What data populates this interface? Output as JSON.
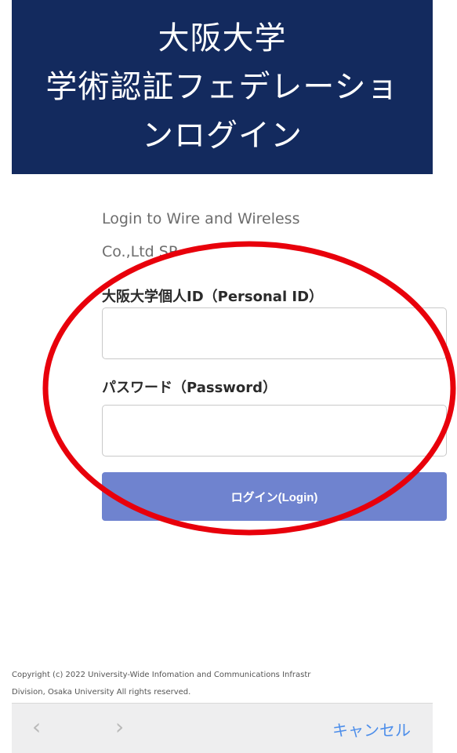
{
  "header": {
    "title_line1": "大阪大学",
    "title_line2": "学術認証フェデレーショ",
    "title_line3": "ンログイン"
  },
  "sp": {
    "line1": "Login to Wire and Wireless",
    "line2": "Co.,Ltd SP"
  },
  "form": {
    "id_label": "大阪大学個人ID（Personal ID）",
    "id_value": "",
    "password_label": "パスワード（Password）",
    "password_value": "",
    "login_button": "ログイン(Login)"
  },
  "footer": {
    "copyright_line1": "Copyright (c) 2022 University-Wide Infomation and Communications Infrastr",
    "copyright_line2": "Division, Osaka University All rights reserved."
  },
  "toolbar": {
    "back_icon": "chevron-left-icon",
    "forward_icon": "chevron-right-icon",
    "cancel_label": "キャンセル"
  },
  "colors": {
    "header_bg": "#132a5e",
    "login_button": "#6f83cf",
    "cancel_link": "#4d8eea",
    "highlight_circle": "#e8000b"
  }
}
